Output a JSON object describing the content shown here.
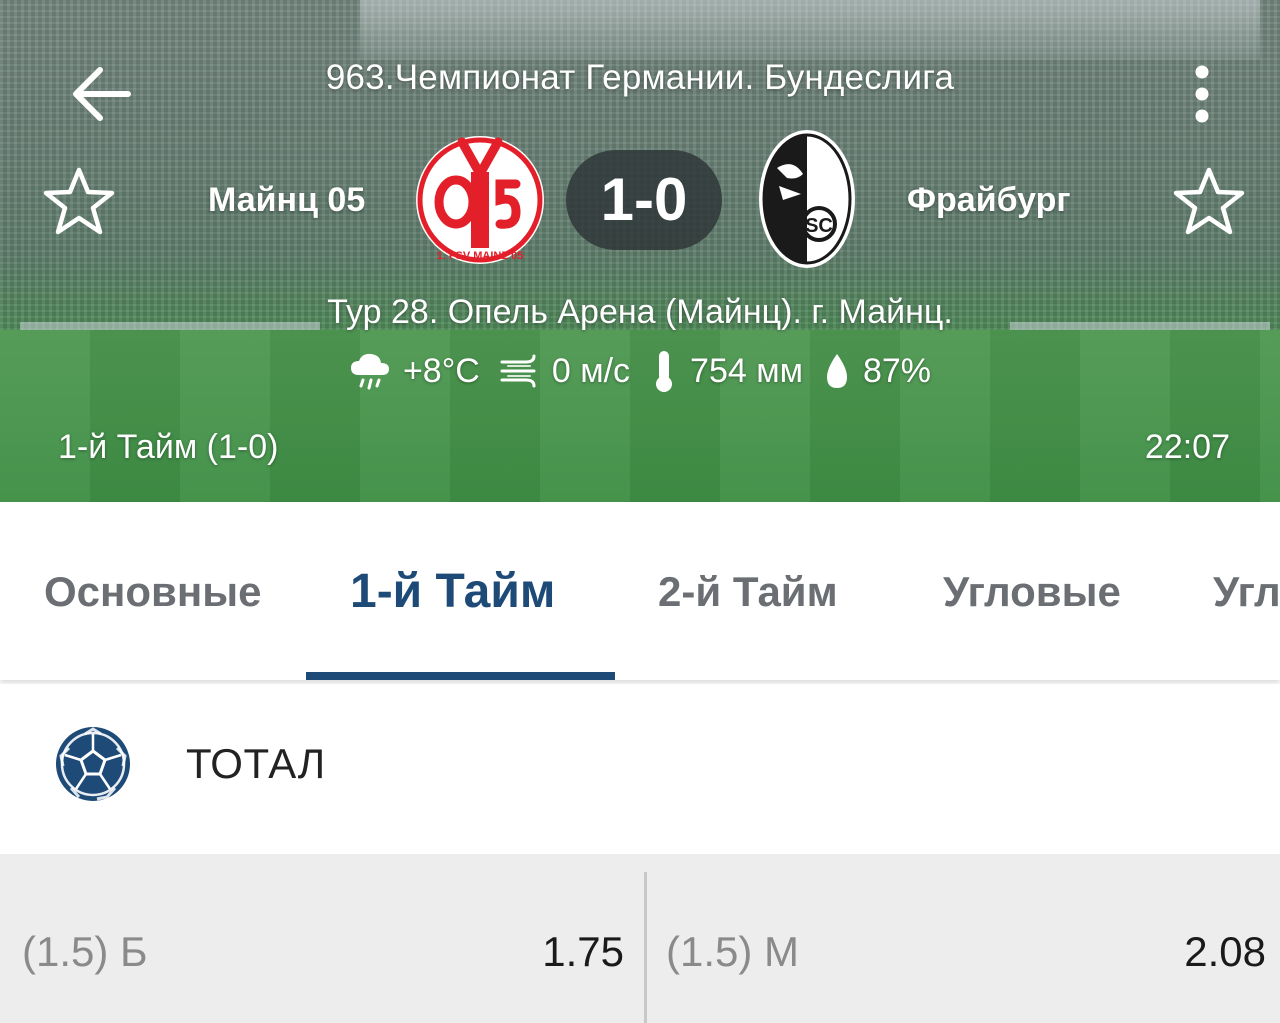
{
  "header": {
    "league_title": "963.Чемпионат Германии. Бундеслига",
    "home_team": {
      "name": "Майнц 05",
      "logo_text": "1. FSV MAINZ 05",
      "logo_mark": "05"
    },
    "away_team": {
      "name": "Фрайбург",
      "logo_mark": "SC"
    },
    "score": "1-0",
    "venue": "Тур 28. Опель Арена (Майнц). г. Майнц.",
    "weather": {
      "temperature": "+8°C",
      "wind": "0 м/с",
      "pressure": "754 мм",
      "humidity": "87%"
    },
    "period": "1-й  Тайм (1-0)",
    "time": "22:07",
    "icons": {
      "back": "arrow-left-icon",
      "menu": "more-vertical-icon",
      "favorite": "star-outline-icon",
      "weather_condition": "rain-cloud-icon",
      "wind": "wind-icon",
      "pressure": "thermometer-icon",
      "humidity": "drop-icon"
    }
  },
  "tabs": [
    {
      "label": "Основные",
      "active": false
    },
    {
      "label": "1-й  Тайм",
      "active": true
    },
    {
      "label": "2-й  Тайм",
      "active": false
    },
    {
      "label": "Угловые",
      "active": false
    },
    {
      "label": "Угл",
      "active": false
    }
  ],
  "market": {
    "title": "ТОТАЛ",
    "icon": "soccer-ball-icon",
    "odds": [
      {
        "label": "(1.5) Б",
        "value": "1.75"
      },
      {
        "label": "(1.5) М",
        "value": "2.08"
      }
    ]
  },
  "colors": {
    "accent": "#1e4a78",
    "tab_inactive": "#6b6f73",
    "mainz_red": "#e3202a",
    "odds_bg": "#ededed"
  }
}
